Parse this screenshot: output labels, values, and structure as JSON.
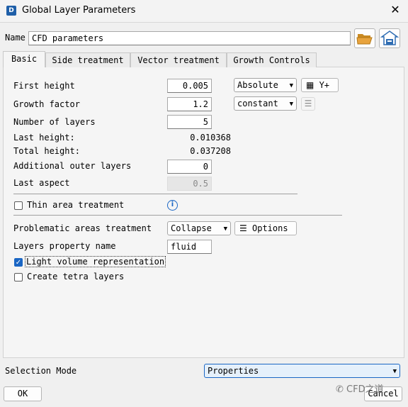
{
  "window": {
    "title": "Global Layer Parameters",
    "icon_text": "D"
  },
  "name_row": {
    "label": "Name",
    "value": "CFD parameters"
  },
  "tabs": [
    {
      "label": "Basic",
      "active": true
    },
    {
      "label": "Side treatment",
      "active": false
    },
    {
      "label": "Vector treatment",
      "active": false
    },
    {
      "label": "Growth Controls",
      "active": false
    }
  ],
  "basic": {
    "first_height": {
      "label": "First height",
      "value": "0.005",
      "mode": "Absolute",
      "yplus_label": "Y+"
    },
    "growth_factor": {
      "label": "Growth factor",
      "value": "1.2",
      "mode": "constant"
    },
    "number_of_layers": {
      "label": "Number of layers",
      "value": "5"
    },
    "last_height": {
      "label": "Last height:",
      "value": "0.010368"
    },
    "total_height": {
      "label": "Total height:",
      "value": "0.037208"
    },
    "additional_outer_layers": {
      "label": "Additional outer layers",
      "value": "0"
    },
    "last_aspect": {
      "label": "Last aspect",
      "value": "0.5"
    },
    "thin_area": {
      "label": "Thin area treatment",
      "checked": false
    },
    "problematic": {
      "label": "Problematic areas treatment",
      "value": "Collapse",
      "options_label": "Options"
    },
    "layers_property": {
      "label": "Layers property name",
      "value": "fluid"
    },
    "light_volume": {
      "label": "Light volume representation",
      "checked": true
    },
    "create_tetra": {
      "label": "Create tetra layers",
      "checked": false
    }
  },
  "selection_mode": {
    "label": "Selection Mode",
    "value": "Properties"
  },
  "footer": {
    "ok_label": "OK",
    "cancel_label": "Cancel",
    "watermark": "CFD之道"
  },
  "colors": {
    "accent": "#1a66c4",
    "folder": "#e8a33d",
    "save": "#2f6db3"
  }
}
